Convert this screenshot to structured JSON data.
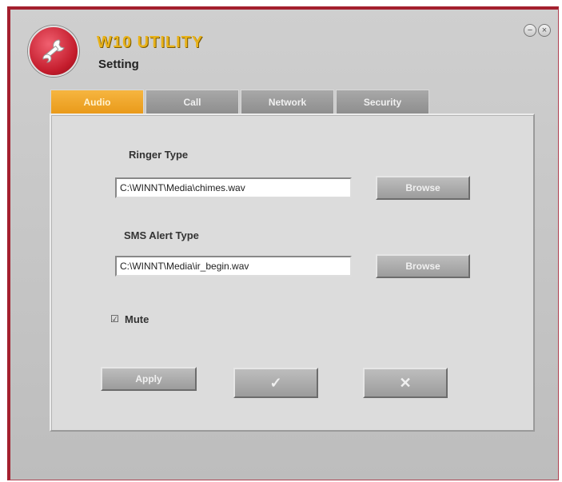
{
  "app": {
    "title": "W10 UTILITY",
    "subtitle": "Setting",
    "minimize_icon": "minimize-icon",
    "close_icon": "close-icon",
    "logo_icon": "wrench-icon"
  },
  "tabs": [
    {
      "label": "Audio",
      "active": true
    },
    {
      "label": "Call",
      "active": false
    },
    {
      "label": "Network",
      "active": false
    },
    {
      "label": "Security",
      "active": false
    }
  ],
  "audio": {
    "ringer_label": "Ringer Type",
    "ringer_value": "C:\\WINNT\\Media\\chimes.wav",
    "ringer_browse": "Browse",
    "sms_label": "SMS Alert Type",
    "sms_value": "C:\\WINNT\\Media\\ir_begin.wav",
    "sms_browse": "Browse",
    "mute_label": "Mute",
    "mute_checked": true
  },
  "actions": {
    "apply_label": "Apply",
    "ok_symbol": "✓",
    "cancel_symbol": "✕"
  },
  "colors": {
    "accent_tab": "#e99a1a",
    "title_gold": "#e8b21a",
    "logo_red": "#c41c2c"
  }
}
